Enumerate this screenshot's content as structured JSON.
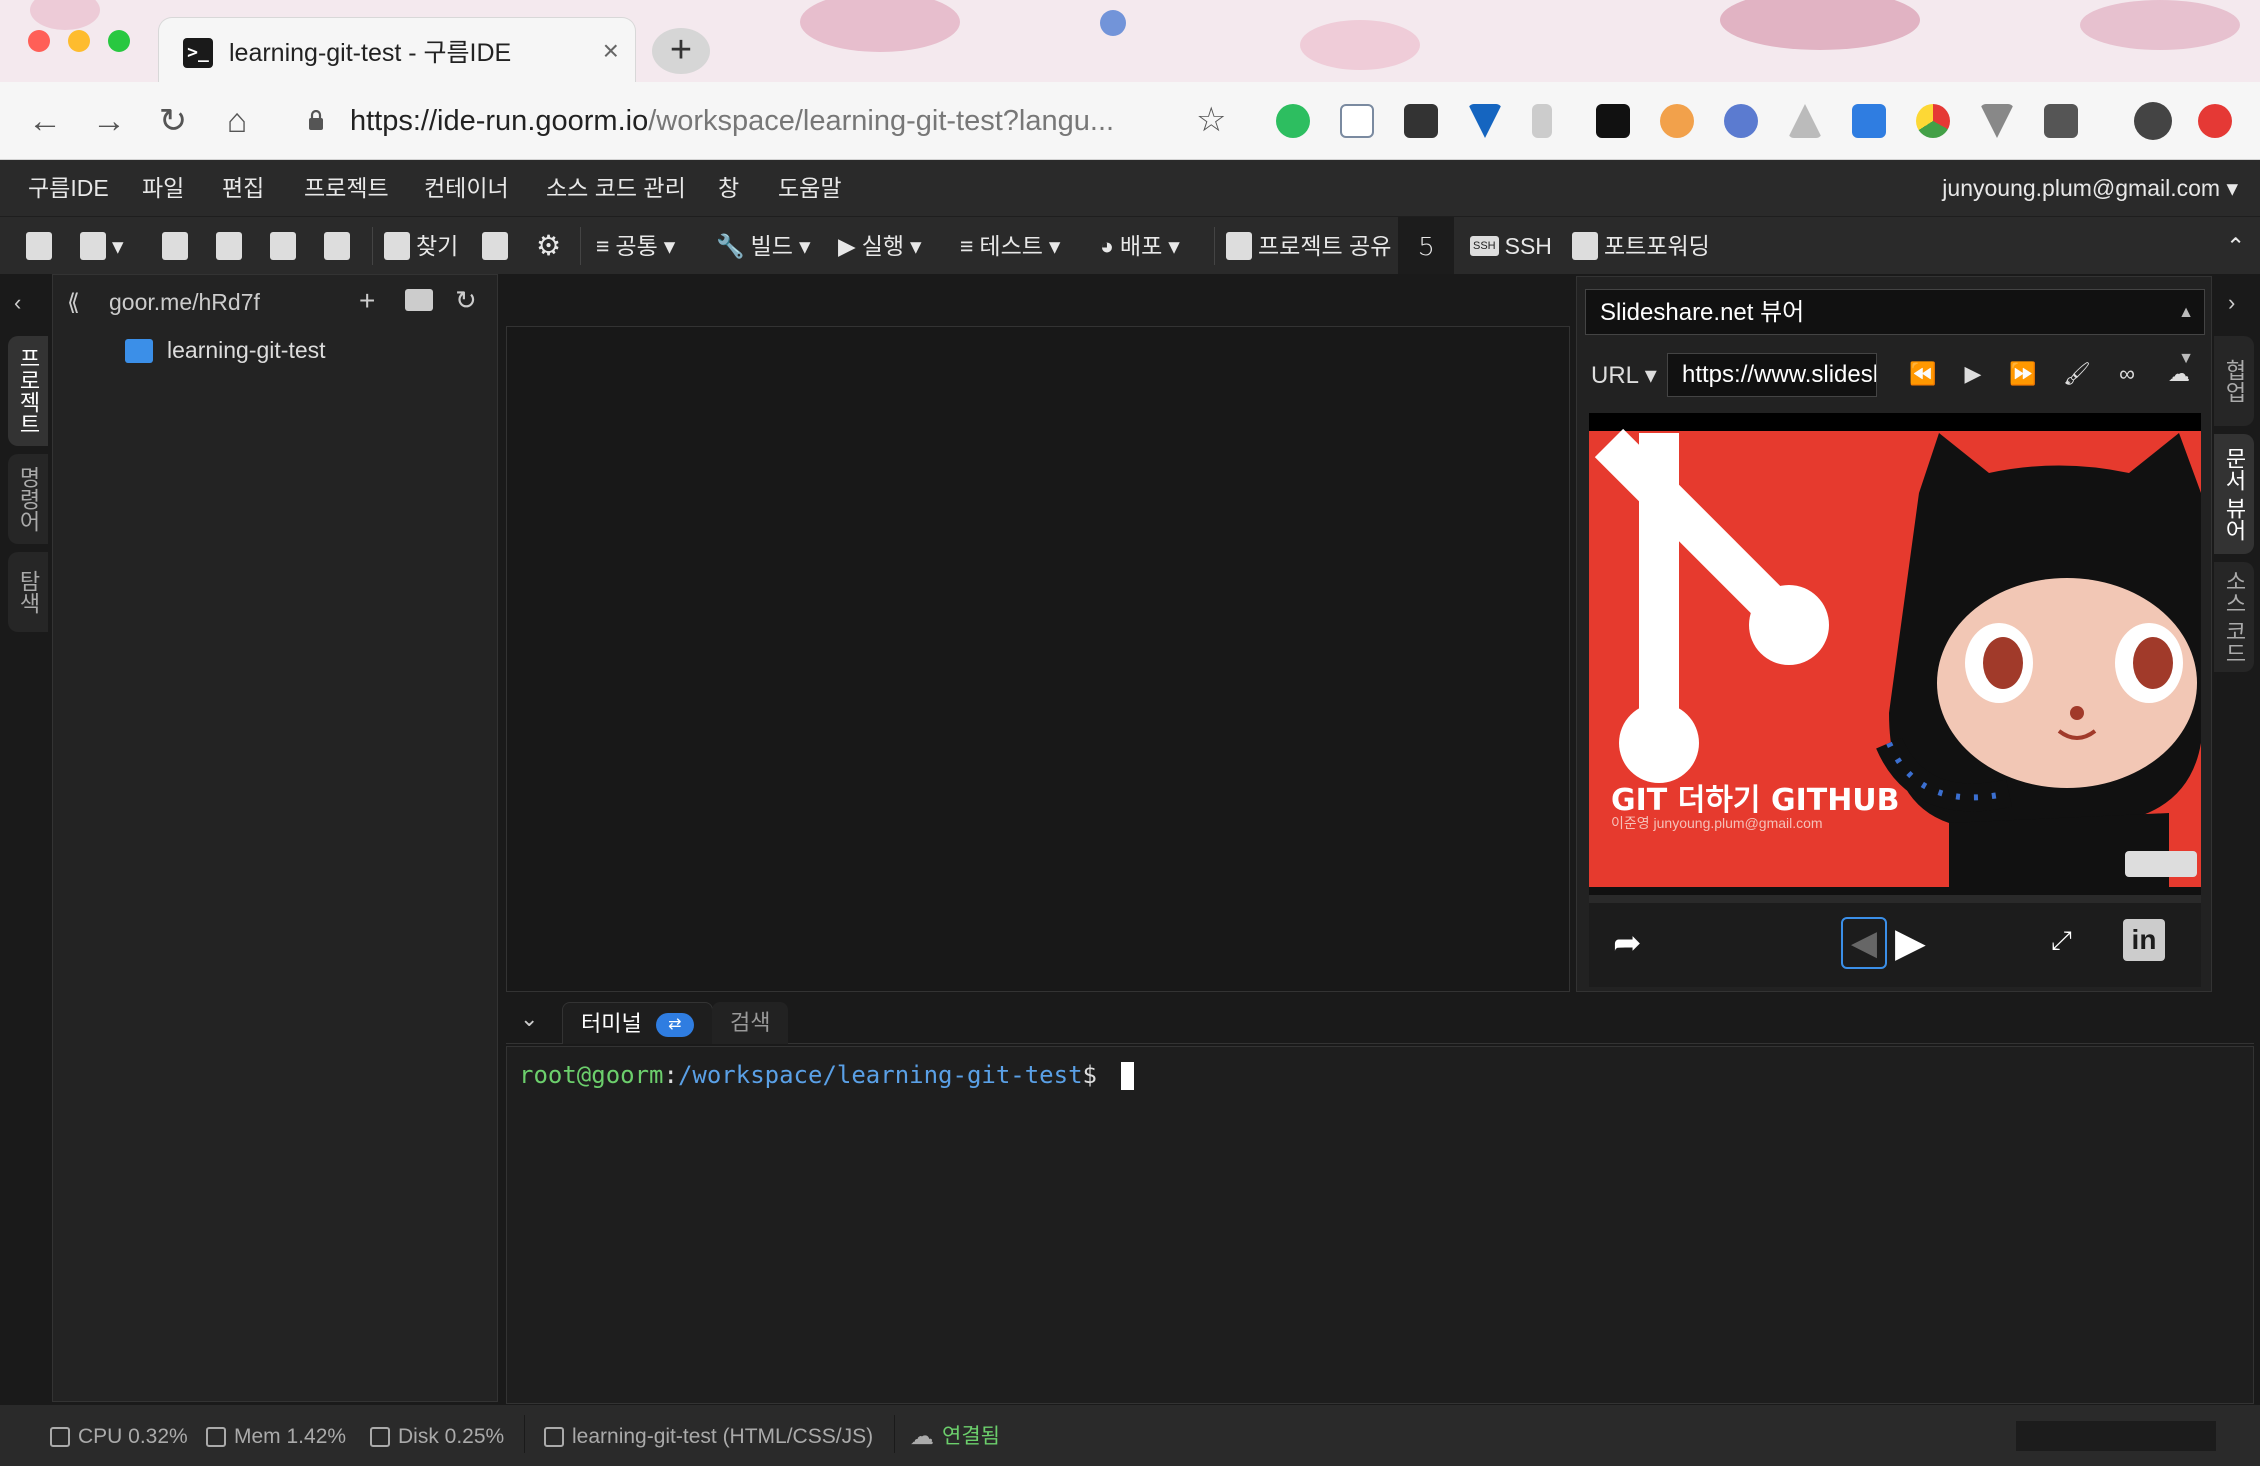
{
  "browser": {
    "tab_title": "learning-git-test - 구름IDE",
    "tab_close": "×",
    "new_tab": "+",
    "url_host": "https://ide-run.goorm.io",
    "url_path": "/workspace/learning-git-test?langu..."
  },
  "ide": {
    "menu": [
      "구름IDE",
      "파일",
      "편집",
      "프로젝트",
      "컨테이너",
      "소스 코드 관리",
      "창",
      "도움말"
    ],
    "account": "junyoung.plum@gmail.com",
    "toolbar": {
      "find": "찾기",
      "common": "공통",
      "build": "빌드",
      "run": "실행",
      "test": "테스트",
      "deploy": "배포",
      "share": "프로젝트 공유",
      "ssh_badge": "SSH",
      "ssh": "SSH",
      "port_forwarding": "포트포워딩"
    },
    "left_tabs": [
      "프로젝트",
      "명령어",
      "탐색"
    ],
    "project": {
      "share_url": "goor.me/hRd7f",
      "root": "learning-git-test"
    },
    "right_tabs": [
      "협업",
      "문서 뷰어",
      "소스 코드"
    ],
    "slideshare": {
      "viewer": "Slideshare.net 뷰어",
      "url_label": "URL",
      "url_value": "https://www.slideshare.net",
      "slide_title": "GIT 더하기 GITHUB",
      "slide_author": "이준영 junyoung.plum@gmail.com"
    },
    "terminal": {
      "tab_terminal": "터미널",
      "tab_search": "검색",
      "prompt_user": "root@goorm",
      "prompt_path": "/workspace/learning-git-test",
      "prompt_symbol": "$"
    },
    "status": {
      "cpu": "CPU 0.32%",
      "mem": "Mem 1.42%",
      "disk": "Disk 0.25%",
      "project": "learning-git-test (HTML/CSS/JS)",
      "connection": "연결됨"
    }
  },
  "colors": {
    "ide_bg": "#1a1a1a",
    "accent_blue": "#3b8fe8",
    "prompt_green": "#6ccf6c",
    "prompt_blue": "#5aa0e6",
    "connected_green": "#6ccf6c",
    "slide_red": "#e63a2e"
  }
}
